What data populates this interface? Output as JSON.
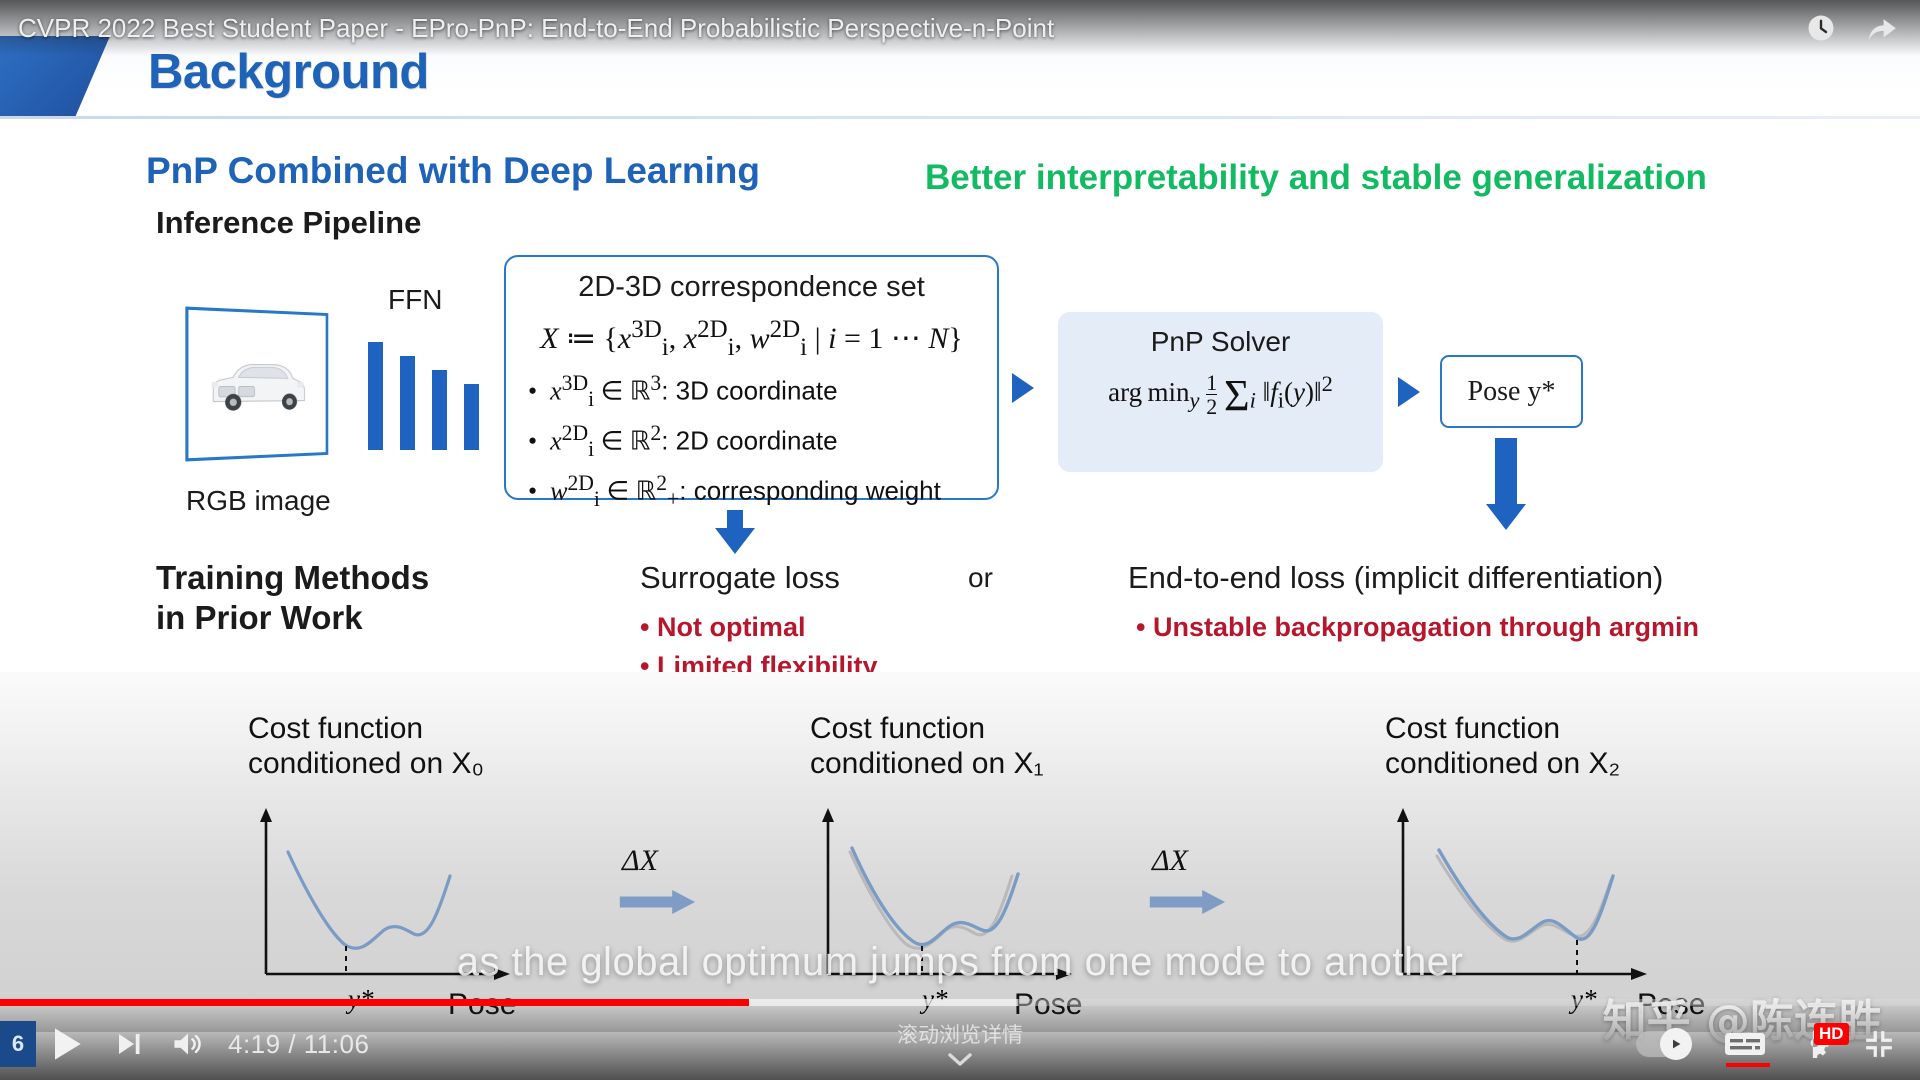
{
  "player": {
    "video_title": "CVPR 2022 Best Student Paper - EPro-PnP: End-to-End Probabilistic Perspective-n-Point",
    "top_icons": [
      {
        "name": "watch-later-icon",
        "glyph": "clock"
      },
      {
        "name": "share-icon",
        "glyph": "share"
      }
    ],
    "page_number": "6",
    "play_label": "Play",
    "next_label": "Next",
    "volume_label": "Volume",
    "time_current": "4:19",
    "time_separator": "/",
    "time_total": "11:06",
    "time_display": "4:19 / 11:06",
    "progress_percent": 39,
    "buffer_percent": 53,
    "scroll_hint": "滚动浏览详情",
    "chevron": "⌄",
    "autoplay_label": "Autoplay",
    "subtitles_label": "Subtitles",
    "quality_badge": "HD",
    "quality_label": "Settings",
    "fullscreen_label": "Exit full screen",
    "accent_color": "#ff0000",
    "page_chip_color": "#1b4a8a"
  },
  "overlay": {
    "subtitle_text": "as the global optimum jumps from one mode to another",
    "watermark": "知乎 @陈连胜"
  },
  "slide": {
    "header_title": "Background",
    "header_title_color": "#1f63b8",
    "section_title": "PnP Combined with Deep Learning",
    "section_title_color": "#1f63b8",
    "banner_right": "Better interpretability and stable generalization",
    "banner_right_color": "#12bb62",
    "subsection": "Inference Pipeline",
    "pipeline": {
      "image_label": "RGB image",
      "ffn_label": "FFN",
      "corr_box": {
        "title": "2D-3D correspondence set",
        "equation": "X ≔ {x_i^3D, x_i^2D, w_i^2D | i = 1 ⋯ N}",
        "bullets": [
          "x_i^3D ∈ ℝ³: 3D coordinate",
          "x_i^2D ∈ ℝ²: 2D coordinate",
          "w_i^2D ∈ ℝ²₊: corresponding weight"
        ]
      },
      "solver_box": {
        "title": "PnP Solver",
        "equation": "arg min_y ½ Σ_i^N ‖f_i(y)‖²"
      },
      "pose_box": "Pose y*"
    },
    "training": {
      "title_line1": "Training Methods",
      "title_line2": "in Prior Work",
      "surrogate_title": "Surrogate loss",
      "or_label": "or",
      "surrogate_bullets": [
        "Not optimal",
        "Limited flexibility"
      ],
      "e2e_title": "End-to-end loss (implicit differentiation)",
      "e2e_bullets": [
        "Unstable backpropagation through argmin"
      ],
      "bullet_color": "#b7172d"
    }
  },
  "chart_data": [
    {
      "type": "line",
      "title": "Cost function conditioned on X₀",
      "title_line1": "Cost function",
      "title_line2": "conditioned on X₀",
      "xlabel": "Pose",
      "ylabel": "",
      "optimum_label": "y*",
      "optimum_x": 0.36,
      "series": [
        {
          "name": "cost",
          "color": "#7a9bc4",
          "x": [
            0.06,
            0.15,
            0.25,
            0.36,
            0.46,
            0.55,
            0.63,
            0.7,
            0.78,
            0.88
          ],
          "y": [
            0.82,
            0.6,
            0.38,
            0.2,
            0.27,
            0.33,
            0.31,
            0.29,
            0.48,
            0.76
          ]
        }
      ],
      "grid": false,
      "legend": "none"
    },
    {
      "type": "line",
      "title": "Cost function conditioned on X₁",
      "title_line1": "Cost function",
      "title_line2": "conditioned on X₁",
      "xlabel": "Pose",
      "ylabel": "",
      "optimum_label": "y*",
      "optimum_x": 0.45,
      "series": [
        {
          "name": "previous cost",
          "color": "#b9b9bb",
          "x": [
            0.06,
            0.15,
            0.25,
            0.36,
            0.46,
            0.55,
            0.63,
            0.7,
            0.78,
            0.88
          ],
          "y": [
            0.82,
            0.6,
            0.38,
            0.2,
            0.27,
            0.33,
            0.31,
            0.29,
            0.48,
            0.76
          ]
        },
        {
          "name": "cost",
          "color": "#7a9bc4",
          "x": [
            0.06,
            0.16,
            0.27,
            0.38,
            0.45,
            0.53,
            0.61,
            0.69,
            0.79,
            0.9
          ],
          "y": [
            0.8,
            0.58,
            0.38,
            0.24,
            0.19,
            0.27,
            0.28,
            0.27,
            0.47,
            0.76
          ]
        }
      ],
      "grid": false,
      "legend": "none"
    },
    {
      "type": "line",
      "title": "Cost function conditioned on X₂",
      "title_line1": "Cost function",
      "title_line2": "conditioned on X₂",
      "xlabel": "Pose",
      "ylabel": "",
      "optimum_label": "y*",
      "optimum_x": 0.7,
      "series": [
        {
          "name": "previous cost",
          "color": "#b9b9bb",
          "x": [
            0.08,
            0.18,
            0.3,
            0.41,
            0.5,
            0.58,
            0.66,
            0.74,
            0.84,
            0.93
          ],
          "y": [
            0.78,
            0.58,
            0.4,
            0.28,
            0.22,
            0.26,
            0.25,
            0.24,
            0.45,
            0.7
          ]
        },
        {
          "name": "cost",
          "color": "#7a9bc4",
          "x": [
            0.08,
            0.18,
            0.3,
            0.41,
            0.5,
            0.58,
            0.66,
            0.74,
            0.84,
            0.93
          ],
          "y": [
            0.82,
            0.61,
            0.42,
            0.3,
            0.24,
            0.3,
            0.27,
            0.21,
            0.43,
            0.69
          ]
        }
      ],
      "grid": false,
      "legend": "none"
    }
  ],
  "transitions": [
    {
      "label": "ΔX",
      "direction": "right"
    },
    {
      "label": "ΔX",
      "direction": "right"
    }
  ]
}
